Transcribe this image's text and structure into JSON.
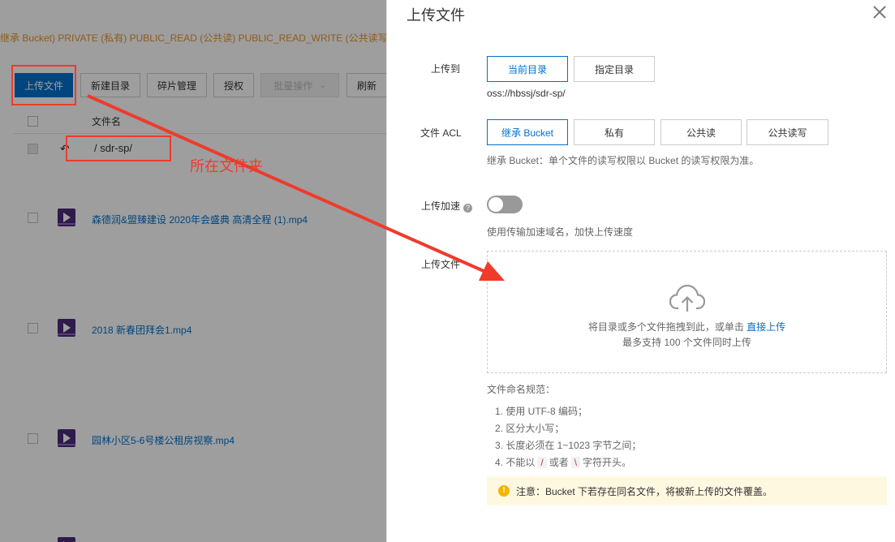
{
  "background": {
    "acl_line": "继承 Bucket) PRIVATE (私有) PUBLIC_READ (公共读) PUBLIC_READ_WRITE (公共读写",
    "toolbar": {
      "upload": "上传文件",
      "new_dir": "新建目录",
      "fragments": "碎片管理",
      "authorize": "授权",
      "batch": "批量操作",
      "refresh": "刷新"
    },
    "table_header_name": "文件名",
    "current_path": "/ sdr-sp/",
    "files": [
      "森德润&盟臻建设  2020年会盛典  高清全程 (1).mp4",
      "2018 新春团拜会1.mp4",
      "园林小区5-6号楼公租房视察.mp4"
    ],
    "annotation_text": "所在文件夹"
  },
  "dialog": {
    "title": "上传文件",
    "upload_to": {
      "label": "上传到",
      "options": [
        "当前目录",
        "指定目录"
      ],
      "selected": "当前目录",
      "path": "oss://hbssj/sdr-sp/"
    },
    "acl": {
      "label": "文件 ACL",
      "options": [
        "继承 Bucket",
        "私有",
        "公共读",
        "公共读写"
      ],
      "selected": "继承 Bucket",
      "hint": "继承 Bucket：单个文件的读写权限以 Bucket 的读写权限为准。"
    },
    "accelerate": {
      "label": "上传加速",
      "help": "?",
      "enabled": false,
      "hint": "使用传输加速域名，加快上传速度"
    },
    "upload_files": {
      "label": "上传文件",
      "drop_text": "将目录或多个文件拖拽到此，或单击",
      "drop_link": "直接上传",
      "limit_text": "最多支持 100 个文件同时上传"
    },
    "naming_rules": {
      "title": "文件命名规范：",
      "rule1": "1. 使用 UTF-8 编码；",
      "rule2": "2. 区分大小写；",
      "rule3": "3. 长度必须在 1~1023 字节之间；",
      "rule4_prefix": "4. 不能以",
      "rule4_code1": "/",
      "rule4_mid": "或者",
      "rule4_code2": "\\",
      "rule4_suffix": "字符开头。"
    },
    "notice": {
      "icon": "!",
      "text": "注意：Bucket 下若存在同名文件，将被新上传的文件覆盖。"
    }
  },
  "colors": {
    "primary": "#0070cc",
    "annotation_red": "#ee3b2c",
    "acl_orange": "#e5952c",
    "notice_bg": "#fff8e1"
  }
}
